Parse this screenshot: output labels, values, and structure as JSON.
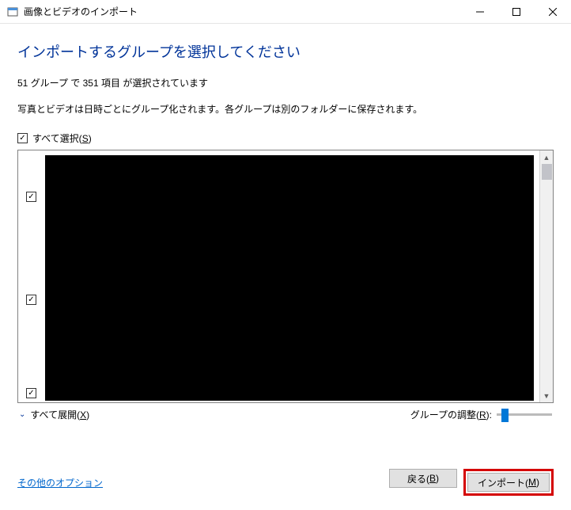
{
  "titlebar": {
    "title": "画像とビデオのインポート"
  },
  "heading": "インポートするグループを選択してください",
  "status": "51 グループ で 351 項目 が選択されています",
  "info": "写真とビデオは日時ごとにグループ化されます。各グループは別のフォルダーに保存されます。",
  "select_all": {
    "label_pre": "すべて選択(",
    "access": "S",
    "label_post": ")",
    "checked": true
  },
  "groups": [
    {
      "checked": true
    },
    {
      "checked": true
    },
    {
      "checked": true
    }
  ],
  "expand_all": {
    "label_pre": "すべて展開(",
    "access": "X",
    "label_post": ")"
  },
  "slider": {
    "label_pre": "グループの調整(",
    "access": "R",
    "label_post": "):"
  },
  "footer": {
    "options_link": "その他のオプション",
    "back": {
      "label_pre": "戻る(",
      "access": "B",
      "label_post": ")"
    },
    "import": {
      "label_pre": "インポート(",
      "access": "M",
      "label_post": ")"
    }
  }
}
